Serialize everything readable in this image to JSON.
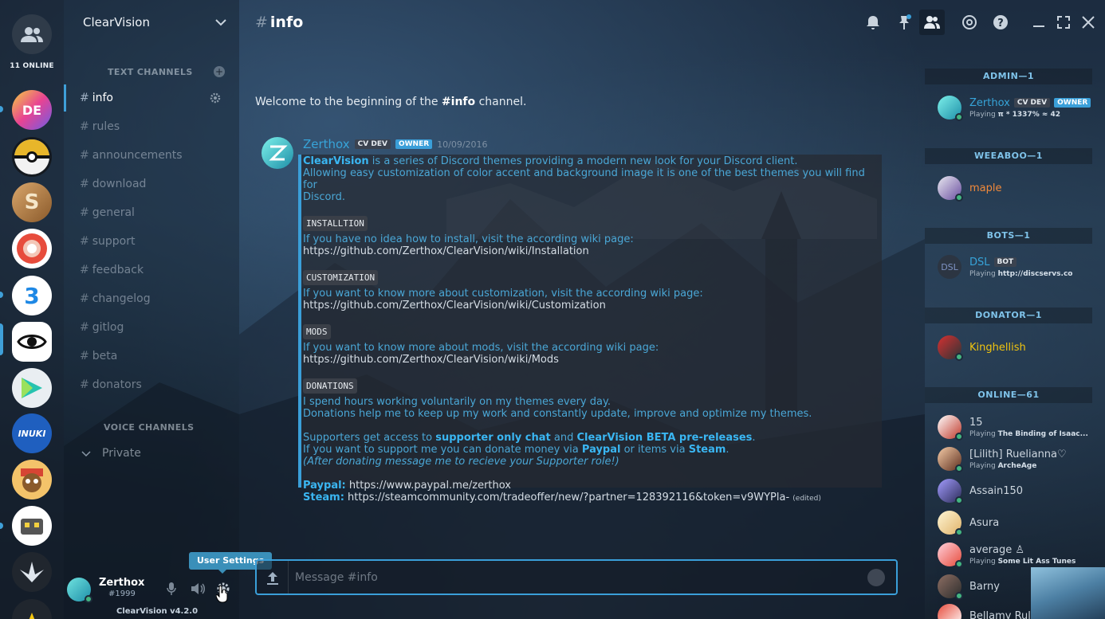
{
  "colors": {
    "accent": "#3a9fd9",
    "owner_tag": "#3a9fd9",
    "online": "#43b581"
  },
  "servers": {
    "online_label": "11 ONLINE",
    "items": [
      {
        "label": "DE",
        "icon": "de-server-icon"
      },
      {
        "label": "",
        "icon": "pokeball-server-icon"
      },
      {
        "label": "S",
        "icon": "s-server-icon"
      },
      {
        "label": "",
        "icon": "red-circle-server-icon"
      },
      {
        "label": "3",
        "icon": "blue-3-server-icon"
      },
      {
        "label": "",
        "icon": "eye-server-icon"
      },
      {
        "label": "",
        "icon": "triangle-server-icon"
      },
      {
        "label": "INUKI",
        "icon": "inuki-server-icon"
      },
      {
        "label": "",
        "icon": "monkey-server-icon"
      },
      {
        "label": "",
        "icon": "robot-server-icon"
      },
      {
        "label": "",
        "icon": "blade-server-icon"
      }
    ]
  },
  "guild": {
    "name": "ClearVision",
    "text_category": "TEXT CHANNELS",
    "voice_category": "VOICE CHANNELS",
    "text_channels": [
      "info",
      "rules",
      "announcements",
      "download",
      "general",
      "support",
      "feedback",
      "changelog",
      "gitlog",
      "beta",
      "donators"
    ],
    "voice_channels": [
      "Private"
    ]
  },
  "user": {
    "name": "Zerthox",
    "discriminator": "#1999",
    "tooltip": "User Settings",
    "version": "ClearVision v4.2.0"
  },
  "chat": {
    "channel": "info",
    "welcome_prefix": "Welcome to the beginning of the ",
    "welcome_channel": "#info",
    "welcome_suffix": " channel.",
    "message": {
      "author": "Zerthox",
      "tag_dev": "CV DEV",
      "tag_owner": "OWNER",
      "timestamp": "10/09/2016",
      "intro_bold": "ClearVision",
      "intro_line1": " is a series of Discord themes providing a modern new look for your Discord client.",
      "intro_line2": "Allowing easy customization of color accent and background image it is one of the best themes you will find for",
      "intro_line3": "Discord.",
      "sections": [
        {
          "label": "INSTALLTION",
          "line1": "If you have no idea how to install, visit the according wiki page:",
          "url": "https://github.com/Zerthox/ClearVision/wiki/Installation"
        },
        {
          "label": "CUSTOMIZATION",
          "line1": "If you want to know more about customization, visit the according wiki page:",
          "url": "https://github.com/Zerthox/ClearVision/wiki/Customization"
        },
        {
          "label": "MODS",
          "line1": "If you want to know more about mods, visit the according wiki page:",
          "url": "https://github.com/Zerthox/ClearVision/wiki/Mods"
        }
      ],
      "donations_label": "DONATIONS",
      "donations_line1": "I spend hours working voluntarily on my themes every day.",
      "donations_line2": "Donations help me to keep up my work and constantly update, improve and optimize my themes.",
      "supporters_pre": "Supporters get access to ",
      "supporters_chat": "supporter only chat",
      "supporters_and": " and ",
      "supporters_beta": "ClearVision BETA pre-releases",
      "supporters_end": ".",
      "support_pre": "If you want to support me you can donate money via ",
      "support_paypal": "Paypal",
      "support_mid": " or items via ",
      "support_steam": "Steam",
      "support_end": ".",
      "after_note": "(After donating message me to recieve your Supporter role!)",
      "paypal_label": "Paypal:",
      "paypal_url": " https://www.paypal.me/zerthox",
      "steam_label": "Steam:",
      "steam_url": " https://steamcommunity.com/tradeoffer/new/?partner=128392116&token=v9WYPla-",
      "edited": "(edited)"
    },
    "input_placeholder": "Message #info"
  },
  "members": {
    "groups": [
      {
        "title": "ADMIN—1"
      },
      {
        "title": "WEEABOO—1"
      },
      {
        "title": "BOTS—1"
      },
      {
        "title": "DONATOR—1"
      },
      {
        "title": "ONLINE—61"
      }
    ],
    "list": [
      {
        "name": "Zerthox",
        "tag1": "CV DEV",
        "tag2": "OWNER",
        "game_prefix": "Playing ",
        "game": "π * 1337% ≈ 42",
        "color": "#37a4d9"
      },
      {
        "name": "maple",
        "color": "#f28a3a"
      },
      {
        "name": "DSL",
        "tag1": "BOT",
        "game_prefix": "Playing ",
        "game": "http://discservs.co",
        "color": "#37a4d9"
      },
      {
        "name": "Kinghellish",
        "color": "#f1c40f"
      },
      {
        "name": "15",
        "game_prefix": "Playing ",
        "game": "The Binding of Isaac...",
        "color": "#cdd6df"
      },
      {
        "name": "[Lilith] Ruelianna♡",
        "game_prefix": "Playing ",
        "game": "ArcheAge",
        "color": "#cdd6df"
      },
      {
        "name": "Assain150",
        "color": "#cdd6df"
      },
      {
        "name": "Asura",
        "color": "#cdd6df"
      },
      {
        "name": "average ♙",
        "game_prefix": "Playing ",
        "game": "Some Lit Ass Tunes",
        "color": "#cdd6df"
      },
      {
        "name": "Barny",
        "color": "#cdd6df"
      },
      {
        "name": "Bellamy Rul",
        "color": "#cdd6df"
      }
    ]
  }
}
